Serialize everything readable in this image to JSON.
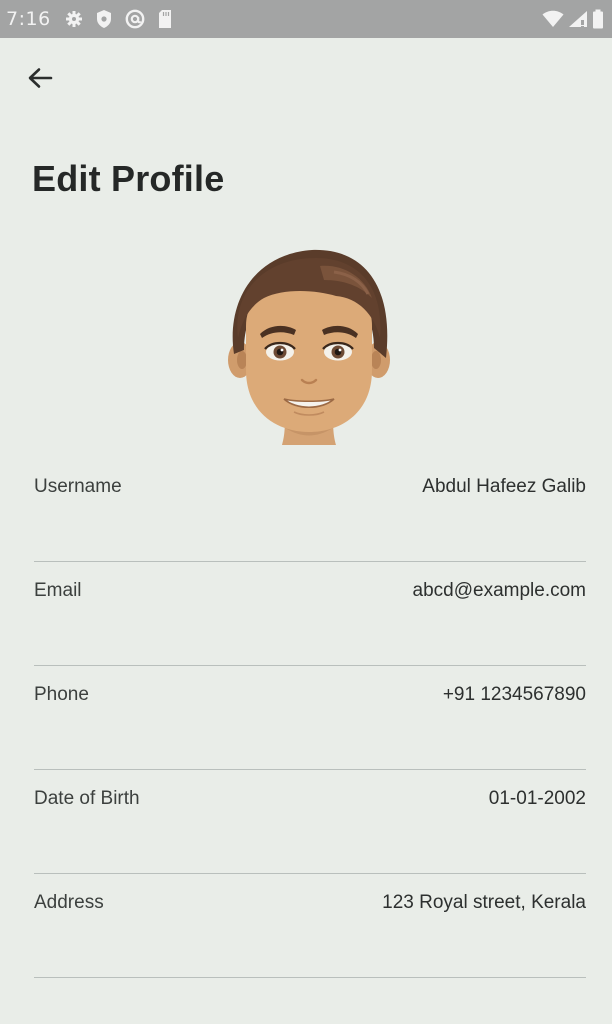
{
  "status_bar": {
    "time": "7:16",
    "left_icons": [
      "gear-icon",
      "shield-icon",
      "at-sign-icon",
      "sd-card-icon"
    ],
    "right_icons": [
      "wifi-icon",
      "signal-icon",
      "battery-icon"
    ]
  },
  "header": {
    "back_icon": "arrow-left-icon",
    "title": "Edit Profile"
  },
  "profile": {
    "avatar_icon": "cartoon-avatar"
  },
  "fields": [
    {
      "label": "Username",
      "value": "Abdul Hafeez Galib"
    },
    {
      "label": "Email",
      "value": "abcd@example.com"
    },
    {
      "label": "Phone",
      "value": "+91 1234567890"
    },
    {
      "label": "Date of Birth",
      "value": "01-01-2002"
    },
    {
      "label": "Address",
      "value": "123 Royal street, Kerala"
    }
  ],
  "colors": {
    "background": "#e9ede8",
    "status_bar": "#a3a4a4",
    "divider": "#b9bfbc",
    "text": "#2a2d2c"
  }
}
